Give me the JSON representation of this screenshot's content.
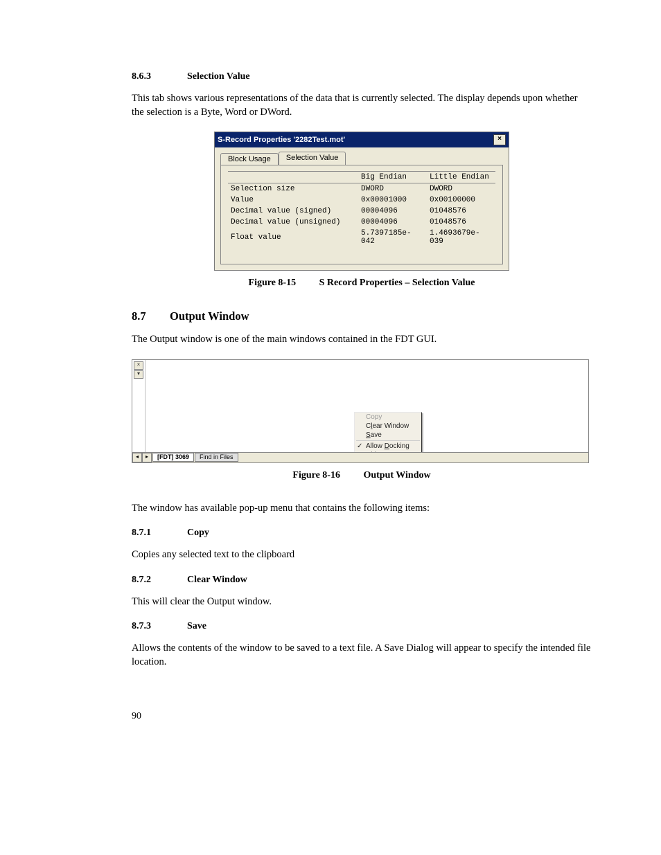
{
  "s863": {
    "num": "8.6.3",
    "title": "Selection Value",
    "para": "This tab shows various representations of the data that is currently selected. The display depends upon whether the selection is a Byte, Word or DWord."
  },
  "dialog": {
    "title": "S-Record Properties '2282Test.mot'",
    "tabs": {
      "blockUsage": "Block Usage",
      "selectionValue": "Selection Value"
    },
    "headers": {
      "big": "Big Endian",
      "little": "Little Endian"
    },
    "rows": [
      {
        "label": "Selection size",
        "big": "DWORD",
        "little": "DWORD"
      },
      {
        "label": "Value",
        "big": "0x00001000",
        "little": "0x00100000"
      },
      {
        "label": "Decimal value (signed)",
        "big": "00004096",
        "little": "01048576"
      },
      {
        "label": "Decimal value (unsigned)",
        "big": "00004096",
        "little": "01048576"
      },
      {
        "label": "Float value",
        "big": "5.7397185e-042",
        "little": "1.4693679e-039"
      }
    ]
  },
  "fig15": {
    "num": "Figure 8-15",
    "title": "S Record Properties – Selection Value"
  },
  "s87": {
    "num": "8.7",
    "title": "Output Window",
    "para": "The Output window is one of the main windows contained in the FDT GUI."
  },
  "output": {
    "tabs": {
      "active": "[FDT] 3069",
      "inactive": "Find in Files"
    },
    "menu": {
      "copy": "Copy",
      "clear_pre": "C",
      "clear_u": "l",
      "clear_post": "ear Window",
      "save_u": "S",
      "save_post": "ave",
      "dock_pre": "Allow ",
      "dock_u": "D",
      "dock_post": "ocking",
      "hide_u": "H",
      "hide_post": "ide"
    }
  },
  "fig16": {
    "num": "Figure 8-16",
    "title": "Output Window"
  },
  "afterOutput": "The window has available pop-up menu that contains the following items:",
  "s871": {
    "num": "8.7.1",
    "title": "Copy",
    "para": "Copies any selected text to the clipboard"
  },
  "s872": {
    "num": "8.7.2",
    "title": "Clear Window",
    "para": "This will clear the Output window."
  },
  "s873": {
    "num": "8.7.3",
    "title": "Save",
    "para": "Allows the contents of the window to be saved to a text file. A Save Dialog will appear to specify the intended file location."
  },
  "pageNumber": "90"
}
